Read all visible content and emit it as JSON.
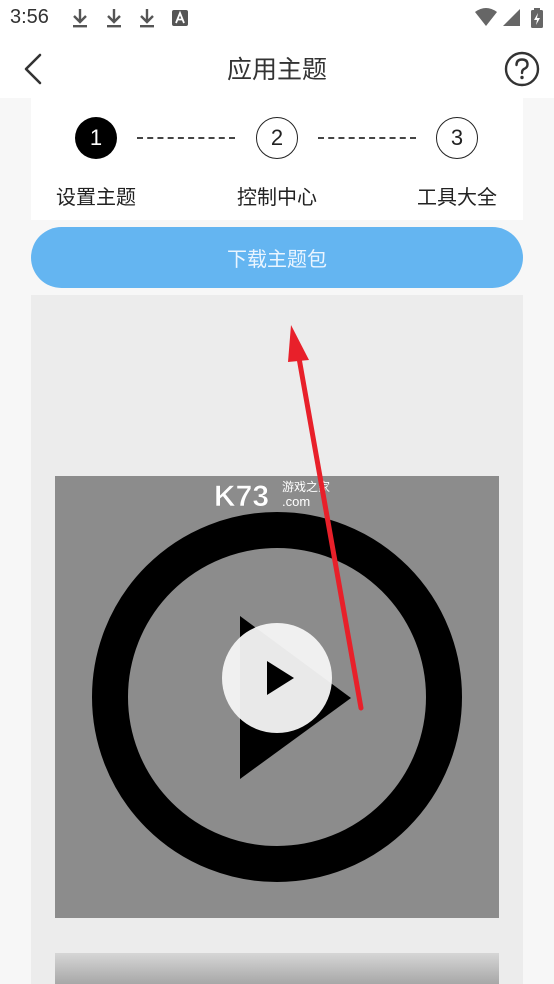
{
  "status_bar": {
    "time": "3:56",
    "left_icons": [
      "download-icon",
      "download-icon",
      "download-icon",
      "font-a-icon"
    ],
    "right_icons": [
      "wifi-icon",
      "signal-icon",
      "battery-charging-icon"
    ]
  },
  "header": {
    "title": "应用主题",
    "back_icon": "chevron-left-icon",
    "help_icon": "question-circle-icon"
  },
  "stepper": {
    "steps": [
      {
        "number": "1",
        "label": "设置主题",
        "active": true
      },
      {
        "number": "2",
        "label": "控制中心",
        "active": false
      },
      {
        "number": "3",
        "label": "工具大全",
        "active": false
      }
    ]
  },
  "download_button": {
    "label": "下载主题包"
  },
  "watermark": {
    "brand": "K73",
    "sub1": "游戏之家",
    "sub2": ".com"
  },
  "colors": {
    "accent": "#64b5f1",
    "arrow": "#e8202a",
    "preview_bg": "#ececec",
    "thumb_bg": "#8c8c8c"
  }
}
